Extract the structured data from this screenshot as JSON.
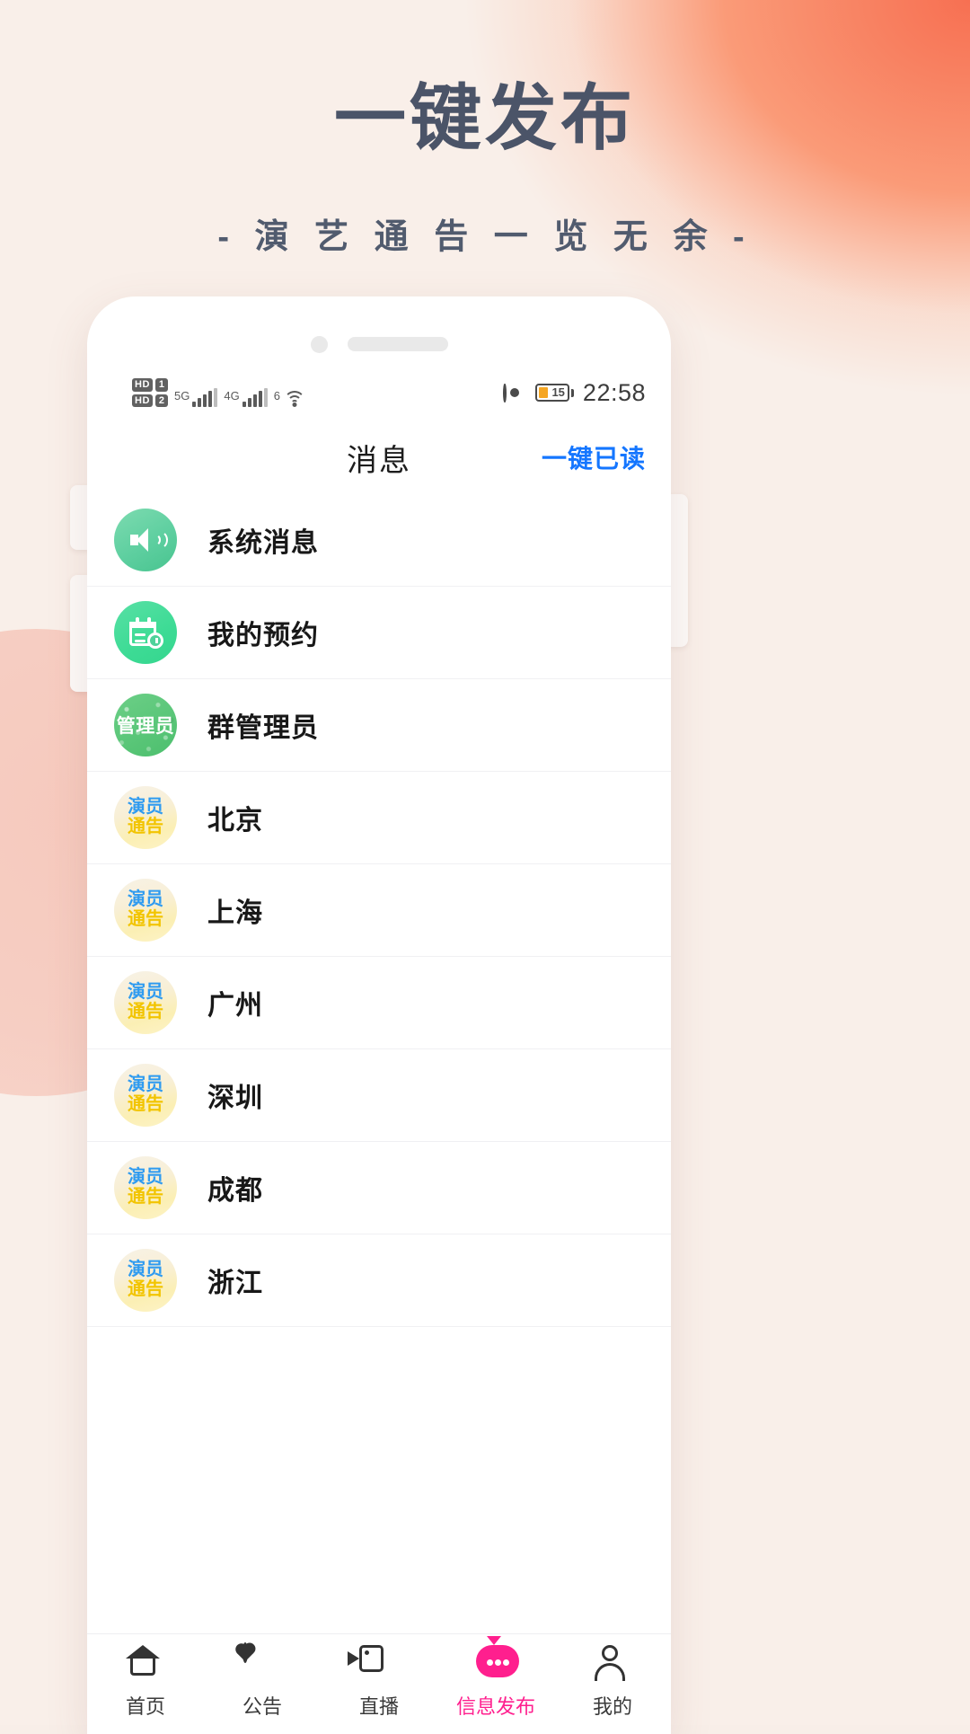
{
  "promo": {
    "title": "一键发布",
    "subtitle": "- 演 艺 通 告 一 览 无 余 -",
    "title_color": "#4b5468",
    "bg_color": "#f9efe9",
    "accent_color": "#f7694a"
  },
  "status_bar": {
    "hd_chip_1": "HD",
    "hd_num_1": "1",
    "hd_chip_2": "HD",
    "hd_num_2": "2",
    "network_1": "5G",
    "network_2": "4G",
    "wifi_label": "6",
    "battery_percent": "15",
    "battery_color": "#f5a623",
    "time": "22:58"
  },
  "app_header": {
    "title": "消息",
    "action_label": "一键已读",
    "action_color": "#1476ff"
  },
  "messages": [
    {
      "name": "系统消息",
      "avatar_type": "speaker"
    },
    {
      "name": "我的预约",
      "avatar_type": "calendar"
    },
    {
      "name": "群管理员",
      "avatar_type": "admin",
      "avatar_text": "管理员"
    },
    {
      "name": "北京",
      "avatar_type": "notice",
      "avatar_line1": "演员",
      "avatar_line2": "通告"
    },
    {
      "name": "上海",
      "avatar_type": "notice",
      "avatar_line1": "演员",
      "avatar_line2": "通告"
    },
    {
      "name": "广州",
      "avatar_type": "notice",
      "avatar_line1": "演员",
      "avatar_line2": "通告"
    },
    {
      "name": "深圳",
      "avatar_type": "notice",
      "avatar_line1": "演员",
      "avatar_line2": "通告"
    },
    {
      "name": "成都",
      "avatar_type": "notice",
      "avatar_line1": "演员",
      "avatar_line2": "通告"
    },
    {
      "name": "浙江",
      "avatar_type": "notice",
      "avatar_line1": "演员",
      "avatar_line2": "通告"
    }
  ],
  "tabbar": {
    "active_color": "#ff1f8e",
    "items": [
      {
        "label": "首页",
        "icon": "home-icon",
        "active": false
      },
      {
        "label": "公告",
        "icon": "heart-circle-icon",
        "active": false
      },
      {
        "label": "直播",
        "icon": "video-camera-icon",
        "active": false
      },
      {
        "label": "信息发布",
        "icon": "chat-bubble-icon",
        "active": true
      },
      {
        "label": "我的",
        "icon": "user-icon",
        "active": false
      }
    ]
  }
}
